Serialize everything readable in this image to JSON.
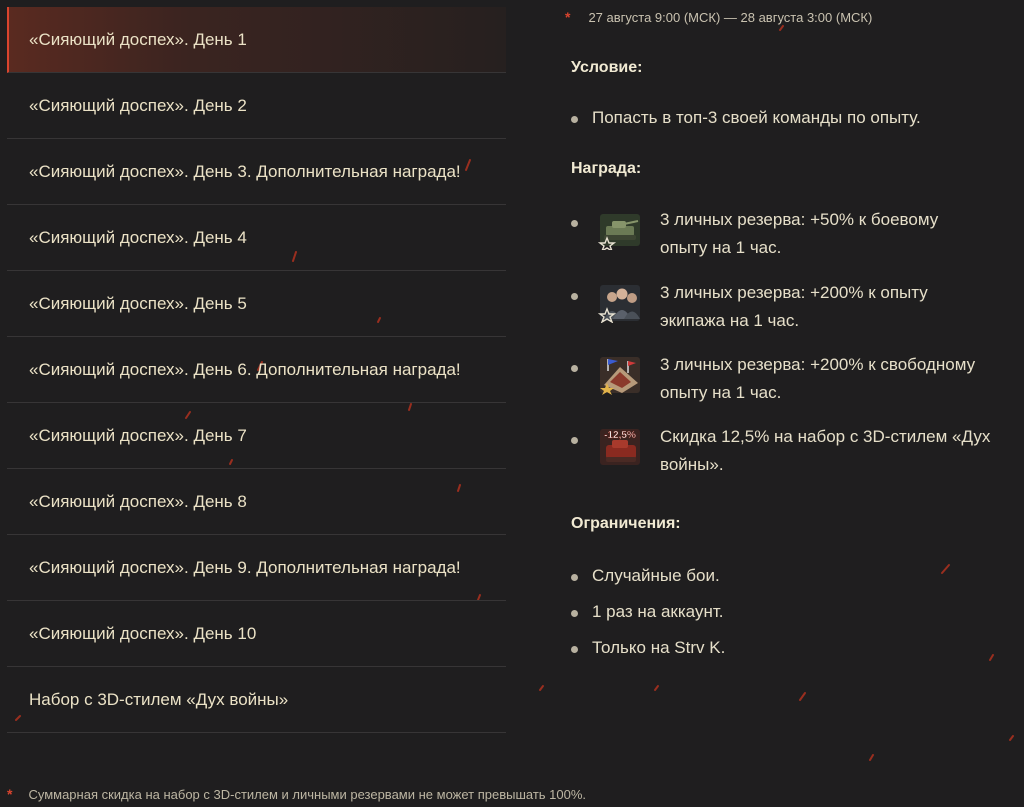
{
  "menu": {
    "items": [
      {
        "label": "«Сияющий доспех». День 1"
      },
      {
        "label": "«Сияющий доспех». День 2"
      },
      {
        "label": "«Сияющий доспех». День 3. Дополнительная награда!"
      },
      {
        "label": "«Сияющий доспех». День 4"
      },
      {
        "label": "«Сияющий доспех». День 5"
      },
      {
        "label": "«Сияющий доспех». День 6. Дополнительная награда!"
      },
      {
        "label": "«Сияющий доспех». День 7"
      },
      {
        "label": "«Сияющий доспех». День 8"
      },
      {
        "label": "«Сияющий доспех». День 9. Дополнительная награда!"
      },
      {
        "label": "«Сияющий доспех». День 10"
      },
      {
        "label": "Набор с 3D-стилем «Дух войны»"
      }
    ]
  },
  "details": {
    "star": "*",
    "date": "27 августа 9:00 (МСК) — 28 августа 3:00 (МСК)",
    "condition_title": "Условие:",
    "condition": "Попасть в топ-3 своей команды по опыту.",
    "reward_title": "Награда:",
    "rewards": [
      {
        "icon": "tank-reserve-icon",
        "line1": "3 личных резерва: +50% к боевому",
        "line2": "опыту на 1 час."
      },
      {
        "icon": "crew-reserve-icon",
        "line1": "3 личных резерва: +200% к опыту",
        "line2": "экипажа на 1 час."
      },
      {
        "icon": "free-xp-reserve-icon",
        "line1": "3 личных резерва: +200% к свободному",
        "line2": "опыту на 1 час."
      },
      {
        "icon": "discount-icon",
        "badge": "-12,5%",
        "line1": "Скидка 12,5% на набор с 3D-стилем «Дух",
        "line2": "войны»."
      }
    ],
    "limits_title": "Ограничения:",
    "limits": [
      "Случайные бои.",
      "1 раз на аккаунт.",
      "Только на Strv K."
    ]
  },
  "footnote": {
    "star": "*",
    "text": "Суммарная скидка на набор с 3D-стилем и личными резервами не может превышать 100%."
  },
  "colors": {
    "background": "#1f1e1f",
    "accent": "#d9442e",
    "text": "#e9e1c9"
  }
}
